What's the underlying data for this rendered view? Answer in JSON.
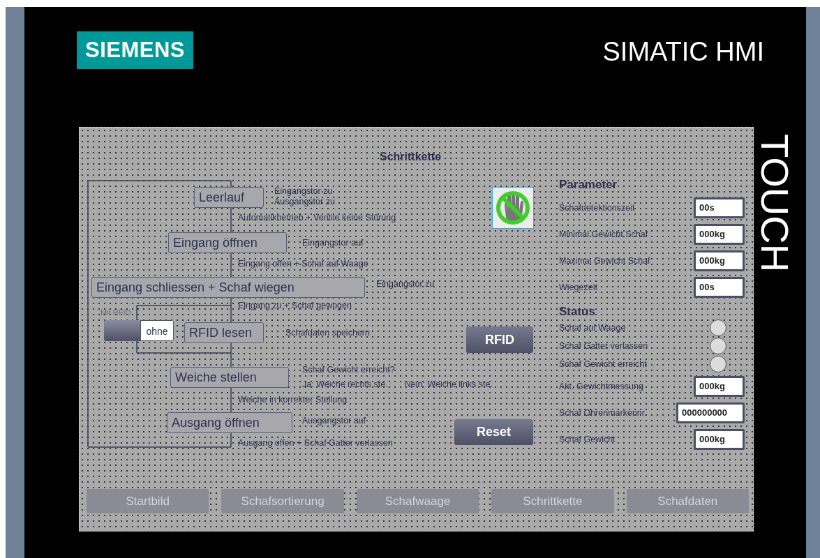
{
  "header": {
    "logo": "SIEMENS",
    "product": "SIMATIC HMI",
    "badge": "TOUCH"
  },
  "screen": {
    "title": "Schrittkette",
    "steps": [
      {
        "label": "Leerlauf",
        "actions": [
          [
            "Eingangstor zu"
          ],
          [
            "Ausgangstor zu"
          ]
        ],
        "transition": "Automatikbetrieb + Ventile keine Störung"
      },
      {
        "label": "Eingang öffnen",
        "actions": [
          [
            "Eingangstor auf"
          ]
        ],
        "transition": "Eingang offen + Schaf auf Waage"
      },
      {
        "label": "Eingang schliessen + Schaf wiegen",
        "actions": [
          [
            "Eingangstor zu"
          ]
        ],
        "transition": "Eingang zu + Schaf gewogen"
      },
      {
        "label": "RFID lesen",
        "actions": [
          [
            "Schafdaten speichern"
          ]
        ]
      },
      {
        "label": "Weiche stellen",
        "actions": [
          [
            "Schaf Gewicht erreicht?"
          ],
          [
            "Ja: Weiche rechts ste.",
            "Nein: Weiche links ste."
          ]
        ],
        "transition": "Weiche in korrekter Stellung"
      },
      {
        "label": "Ausgang öffnen",
        "actions": [
          [
            "Ausgangstor auf"
          ]
        ],
        "transition": "Ausgang offen + Schaf Gatter verlassen"
      }
    ],
    "rfid_switch": {
      "label": "Mit RFID",
      "value": "ohne",
      "on": false
    },
    "buttons": [
      {
        "kind": "rfid",
        "label": "RFID"
      },
      {
        "kind": "reset",
        "label": "Reset"
      }
    ],
    "parameter": {
      "title": "Parameter",
      "rows": [
        {
          "kind": "field",
          "label": "Schafdetektionszeit",
          "value": "00s"
        },
        {
          "kind": "field",
          "label": "Minimal Gewicht Schaf",
          "value": "000kg"
        },
        {
          "kind": "field",
          "label": "Maximal Gewicht Schaf",
          "value": "000kg"
        },
        {
          "kind": "field",
          "label": "Wiegezeit",
          "value": "00s"
        }
      ]
    },
    "status": {
      "title": "Status",
      "rows": [
        {
          "kind": "indicator",
          "label": "Schaf auf Waage",
          "on": false
        },
        {
          "kind": "indicator",
          "label": "Schaf Gatter verlassen",
          "on": false
        },
        {
          "kind": "indicator",
          "label": "Schaf Gewicht erreicht",
          "on": false
        },
        {
          "kind": "field",
          "label": "Akt. Gewichtmessung",
          "value": "000kg"
        },
        {
          "kind": "wide_field",
          "label": "Schaf Ohrenmarkennr.",
          "value": "000000000"
        },
        {
          "kind": "field",
          "label": "Schaf Gewicht",
          "value": "000kg"
        }
      ]
    },
    "nav": [
      {
        "label": "Startbild"
      },
      {
        "label": "Schafsortierung"
      },
      {
        "label": "Schafwaage"
      },
      {
        "label": "Schrittkette"
      },
      {
        "label": "Schafdaten"
      }
    ]
  }
}
